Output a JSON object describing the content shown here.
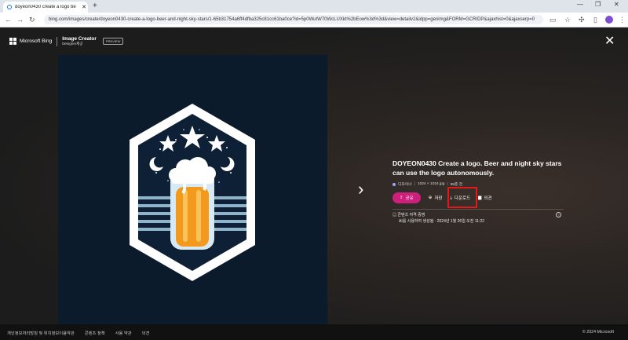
{
  "browser": {
    "tab_title": "doyeon0430 create a logo be",
    "new_tab": "+",
    "url": "bing.com/images/create/doyeon0430-create-a-logo-beer-and-night-sky-stars/1-65b31754a6ff4dfba325c81cc61ba0ce?id=5p0WutW70WcLUXkt%2bEow%3d%3d&view=detailv2&idpp=genimg&FORM=GCRIDP&ajaxhist=0&ajaxserp=0"
  },
  "header": {
    "brand": "Microsoft Bing",
    "app_title": "Image Creator",
    "app_subtitle": "Designer제공",
    "badge": "PREVIEW"
  },
  "detail": {
    "prompt": "DOYEON0430 Create a logo. Beer and night sky stars can use the logo autonomously.",
    "meta_creator": "디자이너",
    "meta_size": "1024 × 1024 jpg",
    "meta_time": "98준 전",
    "share_label": "공유",
    "save_label": "저장",
    "download_label": "다운로드",
    "feedback_label": "의견",
    "credentials_title": "콘텐츠 자격 증명",
    "credentials_detail": "AI를 사용하여 생성됨 · 2024년 1월 26일 오전 11:22"
  },
  "footer": {
    "links": [
      "개인정보처리방침 및 위치정보이용약관",
      "콘텐츠 정책",
      "사용 약관",
      "의견"
    ],
    "copyright": "© 2024 Microsoft"
  },
  "colors": {
    "share": "#cf1f7c",
    "highlight": "#e01919",
    "image_bg": "#0c1b2c",
    "beer": "#f39a1e"
  }
}
